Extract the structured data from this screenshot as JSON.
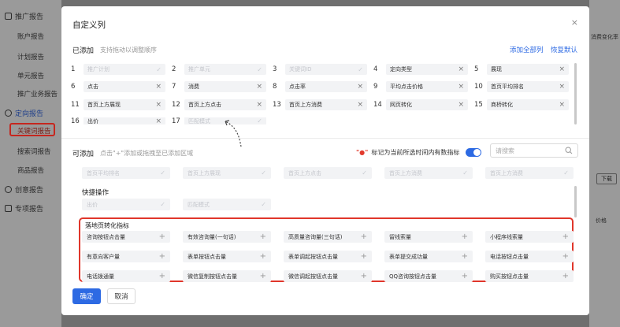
{
  "sidebar": {
    "groups": [
      {
        "label": "推广报告",
        "icon": "trend-icon"
      },
      {
        "label": "定向报告",
        "icon": "target-icon"
      },
      {
        "label": "创意报告",
        "icon": "play-icon"
      },
      {
        "label": "专项报告",
        "icon": "doc-icon"
      }
    ],
    "items": [
      "账户报告",
      "计划报告",
      "单元报告",
      "推广业务报告",
      "关键词报告",
      "搜索词报告",
      "商品报告"
    ]
  },
  "background": {
    "right_header": "消费变化率",
    "download": "下载",
    "price": "价格"
  },
  "modal": {
    "title": "自定义列",
    "close": "×",
    "added": {
      "title": "已添加",
      "hint": "支持拖动以调整顺序",
      "add_all": "添加全部列",
      "reset": "恢复默认",
      "items": [
        {
          "n": "1",
          "label": "推广计划",
          "placeholder": true
        },
        {
          "n": "2",
          "label": "推广单元",
          "placeholder": true
        },
        {
          "n": "3",
          "label": "关键词ID",
          "placeholder": true
        },
        {
          "n": "4",
          "label": "定向类型",
          "placeholder": false
        },
        {
          "n": "5",
          "label": "展现",
          "placeholder": false
        },
        {
          "n": "6",
          "label": "点击",
          "placeholder": false
        },
        {
          "n": "7",
          "label": "消费",
          "placeholder": false
        },
        {
          "n": "8",
          "label": "点击率",
          "placeholder": false
        },
        {
          "n": "9",
          "label": "平均点击价格",
          "placeholder": false
        },
        {
          "n": "10",
          "label": "首页平均排名",
          "placeholder": false
        },
        {
          "n": "11",
          "label": "首页上方展现",
          "placeholder": false
        },
        {
          "n": "12",
          "label": "首页上方点击",
          "placeholder": false
        },
        {
          "n": "13",
          "label": "首页上方消费",
          "placeholder": false
        },
        {
          "n": "14",
          "label": "网页转化",
          "placeholder": false
        },
        {
          "n": "15",
          "label": "商桥转化",
          "placeholder": false
        },
        {
          "n": "16",
          "label": "出价",
          "placeholder": false
        },
        {
          "n": "17",
          "label": "匹配模式",
          "placeholder": true
        }
      ]
    },
    "available": {
      "title": "可添加",
      "hint": "点击\"+\"添加或拖拽至已添加区域",
      "legend": "标记为当前所选时间内有数指标",
      "search_placeholder": "请搜索",
      "top_row": [
        "首页平均排名",
        "首页上方展现",
        "首页上方点击",
        "首页上方消费",
        "首页上方消费"
      ],
      "quick_title": "快捷操作",
      "quick_items": [
        "出价",
        "匹配模式"
      ],
      "group_title": "落地页转化指标",
      "group_items": [
        "咨询按钮点击量",
        "有效咨询量(一句话)",
        "高质量咨询量(三句话)",
        "留线索量",
        "小程序线索量",
        "有意向客户量",
        "表单按钮点击量",
        "表单调起按钮点击量",
        "表单提交成功量",
        "电话按钮点击量",
        "电话拨通量",
        "微信复制按钮点击量",
        "微信调起按钮点击量",
        "QQ咨询按钮点击量",
        "购买按钮点击量"
      ]
    },
    "confirm": "确定",
    "cancel": "取消"
  },
  "colors": {
    "accent": "#2d6ae3",
    "highlight_border": "#e0362b",
    "chip_bg": "#f2f3f5"
  }
}
